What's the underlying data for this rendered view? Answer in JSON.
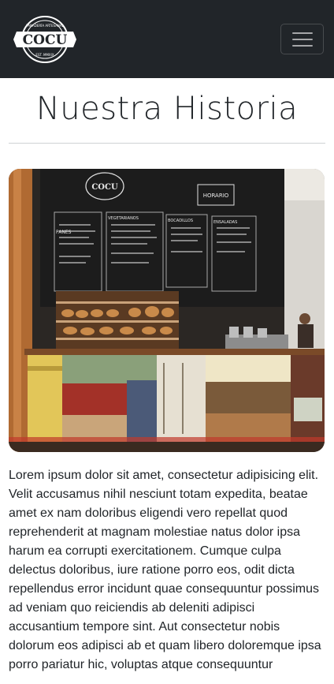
{
  "navbar": {
    "logo": {
      "name": "COCU",
      "arc_top": "PANADERÍA ARTESANAL",
      "arc_bottom": "EST. MMXIX"
    },
    "toggler_icon": "hamburger-menu-icon",
    "colors": {
      "background": "#212529",
      "toggler_bar": "#9a9c9e"
    }
  },
  "page": {
    "title": "Nuestra Historia",
    "image_alt": "Interior de la cafetería con pizarra de menú y mostrador de madera",
    "menu_board": {
      "logo": "COCU",
      "horario": "HORARIO",
      "sections": [
        "PANES",
        "VEGETARIANOS",
        "BOCADILLOS",
        "ENSALADAS"
      ]
    },
    "paragraph": "Lorem ipsum dolor sit amet, consectetur adipisicing elit. Velit accusamus nihil nesciunt totam expedita, beatae amet ex nam doloribus eligendi vero repellat quod reprehenderit at magnam molestiae natus dolor ipsa harum ea corrupti exercitationem. Cumque culpa delectus doloribus, iure ratione porro eos, odit dicta repellendus error incidunt quae consequuntur possimus ad veniam quo reiciendis ab deleniti adipisci accusantium tempore sint. Aut consectetur nobis dolorum eos adipisci ab et quam libero doloremque ipsa porro pariatur hic, voluptas atque consequuntur"
  }
}
